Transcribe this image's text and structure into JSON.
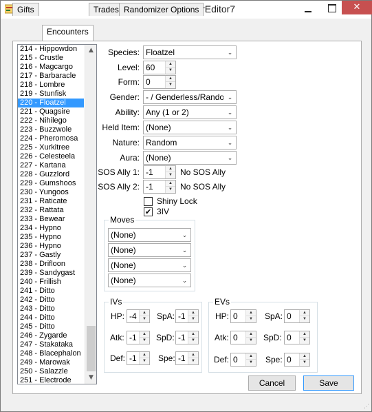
{
  "window": {
    "title": "StaticEncounterEditor7",
    "close_glyph": "✕"
  },
  "tabs": [
    "Gifts",
    "Encounters",
    "Trades",
    "Randomizer Options"
  ],
  "active_tab": "Encounters",
  "encounter_list": [
    "214 - Hippowdon",
    "215 - Crustle",
    "216 - Magcargo",
    "217 - Barbaracle",
    "218 - Lombre",
    "219 - Stunfisk",
    "220 - Floatzel",
    "221 - Quagsire",
    "222 - Nihilego",
    "223 - Buzzwole",
    "224 - Pheromosa",
    "225 - Xurkitree",
    "226 - Celesteela",
    "227 - Kartana",
    "228 - Guzzlord",
    "229 - Gumshoos",
    "230 - Yungoos",
    "231 - Raticate",
    "232 - Rattata",
    "233 - Bewear",
    "234 - Hypno",
    "235 - Hypno",
    "236 - Hypno",
    "237 - Gastly",
    "238 - Drifloon",
    "239 - Sandygast",
    "240 - Frillish",
    "241 - Ditto",
    "242 - Ditto",
    "243 - Ditto",
    "244 - Ditto",
    "245 - Ditto",
    "246 - Zygarde",
    "247 - Stakataka",
    "248 - Blacephalon",
    "249 - Marowak",
    "250 - Salazzle",
    "251 - Electrode"
  ],
  "selected_index": 6,
  "scroll": {
    "up": "▲",
    "down": "▼"
  },
  "form": {
    "species_label": "Species:",
    "species_value": "Floatzel",
    "level_label": "Level:",
    "level_value": "60",
    "form_label": "Form:",
    "form_value": "0",
    "gender_label": "Gender:",
    "gender_value": "- / Genderless/Random",
    "ability_label": "Ability:",
    "ability_value": "Any (1 or 2)",
    "held_item_label": "Held Item:",
    "held_item_value": "(None)",
    "nature_label": "Nature:",
    "nature_value": "Random",
    "aura_label": "Aura:",
    "aura_value": "(None)",
    "sos1_label": "SOS Ally 1:",
    "sos1_value": "-1",
    "sos1_note": "No SOS Ally",
    "sos2_label": "SOS Ally 2:",
    "sos2_value": "-1",
    "sos2_note": "No SOS Ally",
    "shiny_label": "Shiny Lock",
    "shiny_checked": false,
    "iv3_label": "3IV",
    "iv3_checked": true,
    "check_glyph": "✔"
  },
  "moves": {
    "title": "Moves",
    "slots": [
      "(None)",
      "(None)",
      "(None)",
      "(None)"
    ]
  },
  "ivs": {
    "title": "IVs",
    "hp_label": "HP:",
    "hp": "-4",
    "atk_label": "Atk:",
    "atk": "-1",
    "def_label": "Def:",
    "def": "-1",
    "spa_label": "SpA:",
    "spa": "-1",
    "spd_label": "SpD:",
    "spd": "-1",
    "spe_label": "Spe:",
    "spe": "-1"
  },
  "evs": {
    "title": "EVs",
    "hp_label": "HP:",
    "hp": "0",
    "atk_label": "Atk:",
    "atk": "0",
    "def_label": "Def:",
    "def": "0",
    "spa_label": "SpA:",
    "spa": "0",
    "spd_label": "SpD:",
    "spd": "0",
    "spe_label": "Spe:",
    "spe": "0"
  },
  "buttons": {
    "cancel": "Cancel",
    "save": "Save"
  },
  "glyphs": {
    "dropdown": "⌄",
    "spin_up": "▲",
    "spin_down": "▼"
  }
}
